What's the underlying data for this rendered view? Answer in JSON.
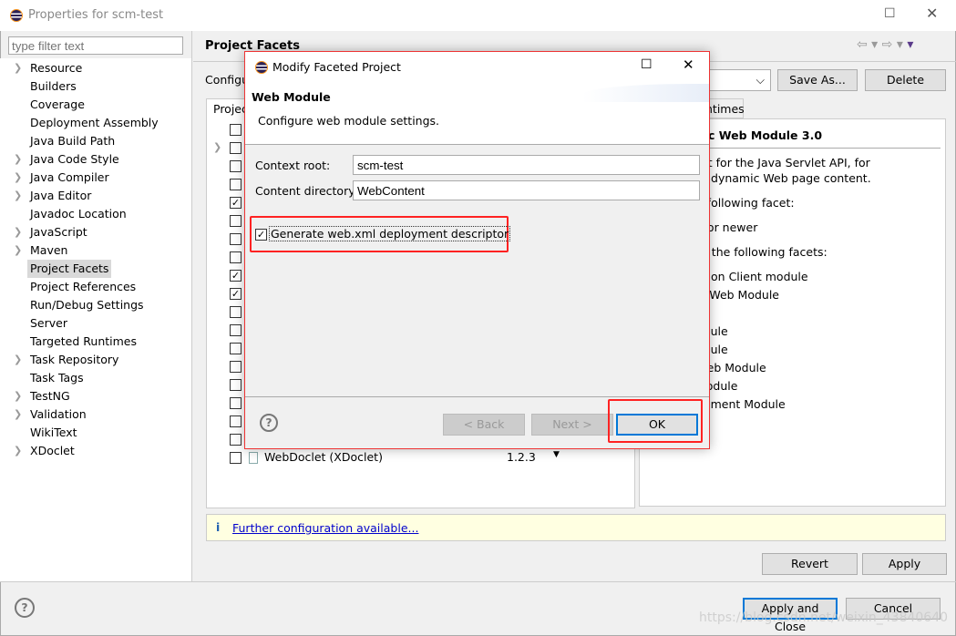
{
  "window": {
    "title": "Properties for scm-test",
    "filter_placeholder": "type filter text"
  },
  "sidebar": {
    "items": [
      {
        "label": "Resource",
        "expandable": true
      },
      {
        "label": "Builders"
      },
      {
        "label": "Coverage"
      },
      {
        "label": "Deployment Assembly"
      },
      {
        "label": "Java Build Path"
      },
      {
        "label": "Java Code Style",
        "expandable": true
      },
      {
        "label": "Java Compiler",
        "expandable": true
      },
      {
        "label": "Java Editor",
        "expandable": true
      },
      {
        "label": "Javadoc Location"
      },
      {
        "label": "JavaScript",
        "expandable": true
      },
      {
        "label": "Maven",
        "expandable": true
      },
      {
        "label": "Project Facets",
        "selected": true
      },
      {
        "label": "Project References"
      },
      {
        "label": "Run/Debug Settings"
      },
      {
        "label": "Server"
      },
      {
        "label": "Targeted Runtimes"
      },
      {
        "label": "Task Repository",
        "expandable": true
      },
      {
        "label": "Task Tags"
      },
      {
        "label": "TestNG",
        "expandable": true
      },
      {
        "label": "Validation",
        "expandable": true
      },
      {
        "label": "WikiText"
      },
      {
        "label": "XDoclet",
        "expandable": true
      }
    ]
  },
  "main": {
    "title": "Project Facets",
    "config_label": "Configu",
    "save_as": "Save As...",
    "delete": "Delete",
    "facets_tab": "Projec",
    "runtimes_tab": "ntimes",
    "facet_checks": [
      false,
      false,
      false,
      false,
      true,
      false,
      false,
      false,
      true,
      true,
      false,
      false,
      false,
      false,
      false,
      false,
      false,
      false,
      false
    ],
    "last_facet": {
      "name": "WebDoclet (XDoclet)",
      "version": "1.2.3"
    },
    "details": {
      "title": "c Web Module 3.0",
      "lines": [
        "ort for the Java Servlet API, for",
        "of dynamic Web page content.",
        "e following facet:",
        "5 or newer",
        "th the following facets:",
        "ation Client module",
        "ic Web Module",
        "",
        "odule",
        "odule",
        "Web Module",
        "Module",
        "agment Module"
      ]
    },
    "info_link": "Further configuration available...",
    "revert": "Revert",
    "apply": "Apply"
  },
  "footer": {
    "apply_close": "Apply and Close",
    "cancel": "Cancel",
    "watermark": "https://blog.csdn.net/weixin_43840640"
  },
  "dialog": {
    "title": "Modify Faceted Project",
    "heading": "Web Module",
    "description": "Configure web module settings.",
    "context_root_label": "Context root:",
    "context_root": "scm-test",
    "content_dir_label": "Content directory:",
    "content_dir": "WebContent",
    "generate_label": "Generate web.xml deployment descriptor",
    "generate_checked": true,
    "back": "< Back",
    "next": "Next >",
    "ok": "OK"
  },
  "colors": {
    "highlight": "#ff2222",
    "accent": "#0078d7",
    "info_bg": "#ffffe1"
  }
}
